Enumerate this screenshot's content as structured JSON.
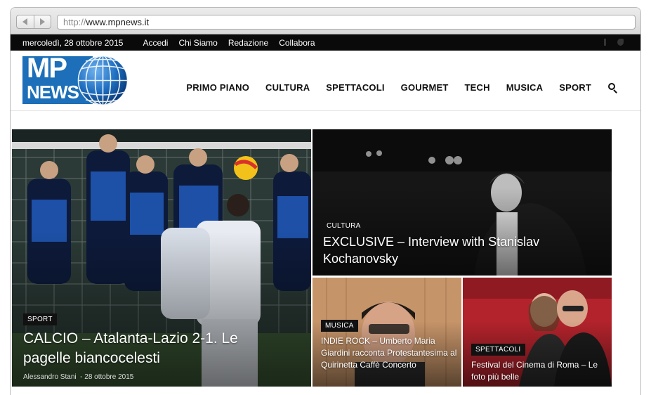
{
  "browser": {
    "url_protocol": "http://",
    "url_host": "www.mpnews.it"
  },
  "topbar": {
    "date": "mercoledì, 28 ottobre 2015",
    "links": [
      "Accedi",
      "Chi Siamo",
      "Redazione",
      "Collabora"
    ],
    "social": [
      "facebook-icon",
      "twitter-icon"
    ]
  },
  "logo": {
    "line1": "MP",
    "line2": "NEWS"
  },
  "nav": {
    "items": [
      "PRIMO PIANO",
      "CULTURA",
      "SPETTACOLI",
      "GOURMET",
      "TECH",
      "MUSICA",
      "SPORT"
    ],
    "search_icon": "search-icon"
  },
  "articles": {
    "sport": {
      "category": "SPORT",
      "title": "CALCIO – Atalanta-Lazio 2-1. Le pagelle biancocelesti",
      "author": "Alessandro Stani",
      "date": "28 ottobre 2015"
    },
    "cultura": {
      "category": "CULTURA",
      "title": "EXCLUSIVE – Interview with Stanislav Kochanovsky"
    },
    "musica": {
      "category": "MUSICA",
      "title": "INDIE ROCK – Umberto Maria Giardini racconta Protestantesima al Quirinetta Caffè Concerto"
    },
    "spettacoli": {
      "category": "SPETTACOLI",
      "title": "Festival del Cinema di Roma – Le foto più belle"
    }
  },
  "colors": {
    "brand": "#1c6fb8",
    "topbar": "#0a0a0a"
  }
}
